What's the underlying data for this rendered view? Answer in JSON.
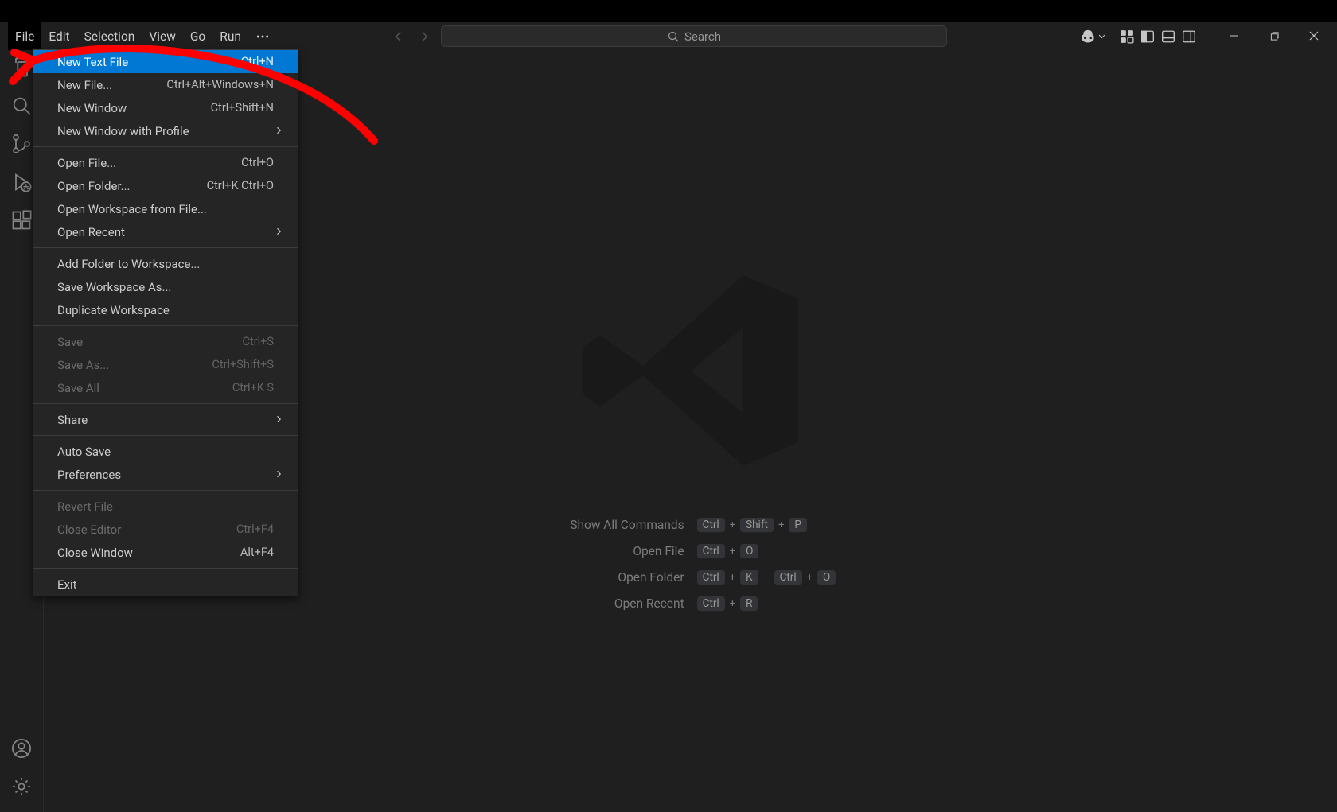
{
  "menubar": {
    "file": "File",
    "edit": "Edit",
    "selection": "Selection",
    "view": "View",
    "go": "Go",
    "run": "Run"
  },
  "search": {
    "placeholder": "Search"
  },
  "file_menu": {
    "group1": [
      {
        "label": "New Text File",
        "shortcut": "Ctrl+N",
        "highlight": true,
        "disabled": false,
        "submenu": false
      },
      {
        "label": "New File...",
        "shortcut": "Ctrl+Alt+Windows+N",
        "highlight": false,
        "disabled": false,
        "submenu": false
      },
      {
        "label": "New Window",
        "shortcut": "Ctrl+Shift+N",
        "highlight": false,
        "disabled": false,
        "submenu": false
      },
      {
        "label": "New Window with Profile",
        "shortcut": "",
        "highlight": false,
        "disabled": false,
        "submenu": true
      }
    ],
    "group2": [
      {
        "label": "Open File...",
        "shortcut": "Ctrl+O",
        "highlight": false,
        "disabled": false,
        "submenu": false
      },
      {
        "label": "Open Folder...",
        "shortcut": "Ctrl+K Ctrl+O",
        "highlight": false,
        "disabled": false,
        "submenu": false
      },
      {
        "label": "Open Workspace from File...",
        "shortcut": "",
        "highlight": false,
        "disabled": false,
        "submenu": false
      },
      {
        "label": "Open Recent",
        "shortcut": "",
        "highlight": false,
        "disabled": false,
        "submenu": true
      }
    ],
    "group3": [
      {
        "label": "Add Folder to Workspace...",
        "shortcut": "",
        "highlight": false,
        "disabled": false,
        "submenu": false
      },
      {
        "label": "Save Workspace As...",
        "shortcut": "",
        "highlight": false,
        "disabled": false,
        "submenu": false
      },
      {
        "label": "Duplicate Workspace",
        "shortcut": "",
        "highlight": false,
        "disabled": false,
        "submenu": false
      }
    ],
    "group4": [
      {
        "label": "Save",
        "shortcut": "Ctrl+S",
        "highlight": false,
        "disabled": true,
        "submenu": false
      },
      {
        "label": "Save As...",
        "shortcut": "Ctrl+Shift+S",
        "highlight": false,
        "disabled": true,
        "submenu": false
      },
      {
        "label": "Save All",
        "shortcut": "Ctrl+K S",
        "highlight": false,
        "disabled": true,
        "submenu": false
      }
    ],
    "group5": [
      {
        "label": "Share",
        "shortcut": "",
        "highlight": false,
        "disabled": false,
        "submenu": true
      }
    ],
    "group6": [
      {
        "label": "Auto Save",
        "shortcut": "",
        "highlight": false,
        "disabled": false,
        "submenu": false
      },
      {
        "label": "Preferences",
        "shortcut": "",
        "highlight": false,
        "disabled": false,
        "submenu": true
      }
    ],
    "group7": [
      {
        "label": "Revert File",
        "shortcut": "",
        "highlight": false,
        "disabled": true,
        "submenu": false
      },
      {
        "label": "Close Editor",
        "shortcut": "Ctrl+F4",
        "highlight": false,
        "disabled": true,
        "submenu": false
      },
      {
        "label": "Close Window",
        "shortcut": "Alt+F4",
        "highlight": false,
        "disabled": false,
        "submenu": false
      }
    ],
    "group8": [
      {
        "label": "Exit",
        "shortcut": "",
        "highlight": false,
        "disabled": false,
        "submenu": false
      }
    ]
  },
  "welcome": {
    "rows": [
      {
        "label": "Show All Commands",
        "keys": [
          "Ctrl",
          "Shift",
          "P"
        ]
      },
      {
        "label": "Open File",
        "keys": [
          "Ctrl",
          "O"
        ]
      },
      {
        "label": "Open Folder",
        "keys": [
          "Ctrl",
          "K",
          "Ctrl",
          "O"
        ]
      },
      {
        "label": "Open Recent",
        "keys": [
          "Ctrl",
          "R"
        ]
      }
    ]
  },
  "annotation": {
    "color": "#ff0000"
  }
}
